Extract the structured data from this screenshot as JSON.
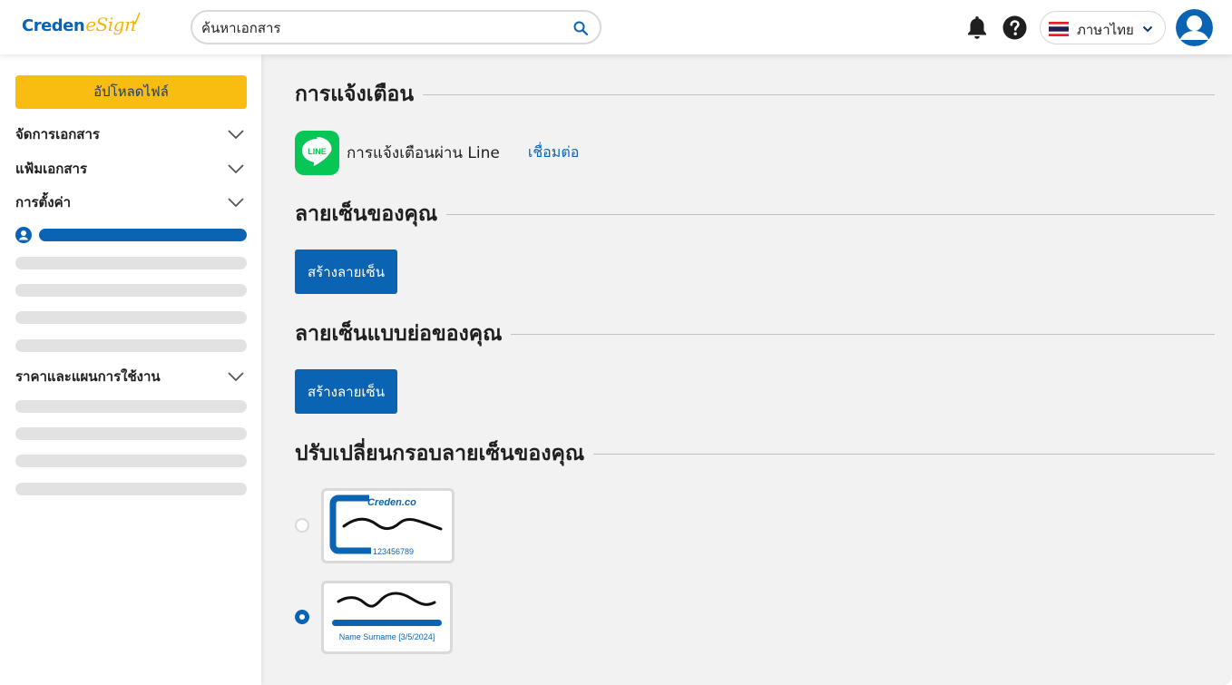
{
  "header": {
    "logo_primary": "Creden",
    "logo_secondary": "eSign",
    "search_placeholder": "ค้นหาเอกสาร",
    "language_label": "ภาษาไทย"
  },
  "sidebar": {
    "upload_label": "อัปโหลดไฟล์",
    "menu": [
      {
        "label": "จัดการเอกสาร"
      },
      {
        "label": "แฟ้มเอกสาร"
      },
      {
        "label": "การตั้งค่า"
      },
      {
        "label": "ราคาและแผนการใช้งาน"
      }
    ]
  },
  "main": {
    "notifications": {
      "title": "การแจ้งเตือน",
      "line_logo_text": "LINE",
      "line_label": "การแจ้งเตือนผ่าน Line",
      "connect_label": "เชื่อมต่อ"
    },
    "signature": {
      "title": "ลายเซ็นของคุณ",
      "button_label": "สร้างลายเซ็น"
    },
    "initials": {
      "title": "ลายเซ็นแบบย่อของคุณ",
      "button_label": "สร้างลายเซ็น"
    },
    "frame": {
      "title": "ปรับเปลี่ยนกรอบลายเซ็นของคุณ",
      "options": [
        {
          "brand_text": "Creden.co",
          "id_text": "123456789",
          "selected": false
        },
        {
          "caption": "Name Surname [3/5/2024]",
          "selected": true
        }
      ]
    }
  },
  "colors": {
    "brand_blue": "#0a63b3",
    "upload_yellow": "#f9bc10",
    "line_green": "#06c755"
  }
}
